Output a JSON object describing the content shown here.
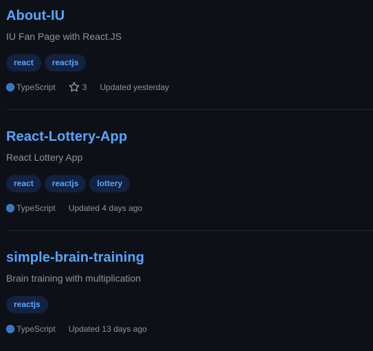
{
  "colors": {
    "background": "#0d1117",
    "link": "#58a6ff",
    "muted": "#8b949e",
    "topic_bg": "#122240",
    "divider": "#21262d",
    "typescript": "#3178c6"
  },
  "repos": [
    {
      "name": "About-IU",
      "description": "IU Fan Page with React.JS",
      "topics": [
        "react",
        "reactjs"
      ],
      "language": "TypeScript",
      "language_color": "#3178c6",
      "stars": "3",
      "updated": "Updated yesterday"
    },
    {
      "name": "React-Lottery-App",
      "description": "React Lottery App",
      "topics": [
        "react",
        "reactjs",
        "lottery"
      ],
      "language": "TypeScript",
      "language_color": "#3178c6",
      "updated": "Updated 4 days ago"
    },
    {
      "name": "simple-brain-training",
      "description": "Brain training with multiplication",
      "topics": [
        "reactjs"
      ],
      "language": "TypeScript",
      "language_color": "#3178c6",
      "updated": "Updated 13 days ago"
    }
  ]
}
